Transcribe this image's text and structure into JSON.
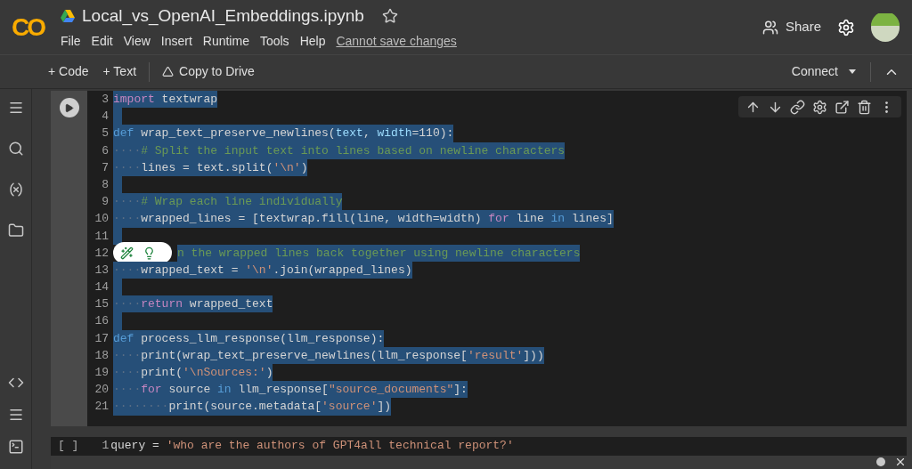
{
  "header": {
    "logo": "CO",
    "title": "Local_vs_OpenAI_Embeddings.ipynb",
    "starred": false,
    "menu": [
      "File",
      "Edit",
      "View",
      "Insert",
      "Runtime",
      "Tools",
      "Help"
    ],
    "save_notice": "Cannot save changes",
    "share": "Share"
  },
  "toolbar": {
    "add_code": "+ Code",
    "add_text": "+ Text",
    "copy": "Copy to Drive",
    "connect": "Connect"
  },
  "cell": {
    "lines": [
      {
        "number": "3",
        "tokens": [
          {
            "kind": "kw",
            "text": "import"
          },
          {
            "kind": "plain",
            "text": " textwrap"
          }
        ]
      },
      {
        "number": "4"
      },
      {
        "number": "5",
        "tokens": [
          {
            "kind": "def",
            "text": "def"
          },
          {
            "kind": "plain",
            "text": " wrap_text_preserve_newlines("
          },
          {
            "kind": "param",
            "text": "text"
          },
          {
            "kind": "plain",
            "text": ", "
          },
          {
            "kind": "param",
            "text": "width"
          },
          {
            "kind": "plain",
            "text": "=110):"
          }
        ]
      },
      {
        "number": "6",
        "indent": "····",
        "tokens": [
          {
            "kind": "comment",
            "text": "# Split the input text into lines based on newline characters"
          }
        ]
      },
      {
        "number": "7",
        "indent": "····",
        "tokens": [
          {
            "kind": "plain",
            "text": "lines = text.split("
          },
          {
            "kind": "str",
            "text": "'\\n'"
          },
          {
            "kind": "plain",
            "text": ")"
          }
        ]
      },
      {
        "number": "8"
      },
      {
        "number": "9",
        "indent": "····",
        "tokens": [
          {
            "kind": "comment",
            "text": "# Wrap each line individually"
          }
        ]
      },
      {
        "number": "10",
        "indent": "····",
        "tokens": [
          {
            "kind": "plain",
            "text": "wrapped_lines = [textwrap.fill(line, width=width) "
          },
          {
            "kind": "kw",
            "text": "for"
          },
          {
            "kind": "plain",
            "text": " line "
          },
          {
            "kind": "def",
            "text": "in"
          },
          {
            "kind": "plain",
            "text": " lines]"
          }
        ]
      },
      {
        "number": "11"
      },
      {
        "number": "12",
        "covered": true,
        "tokens": [
          {
            "kind": "comment",
            "text": "n the wrapped lines back together using newline characters"
          }
        ]
      },
      {
        "number": "13",
        "indent": "····",
        "tokens": [
          {
            "kind": "plain",
            "text": "wrapped_text = "
          },
          {
            "kind": "str",
            "text": "'\\n'"
          },
          {
            "kind": "plain",
            "text": ".join(wrapped_lines)"
          }
        ]
      },
      {
        "number": "14"
      },
      {
        "number": "15",
        "indent": "····",
        "tokens": [
          {
            "kind": "kw",
            "text": "return"
          },
          {
            "kind": "plain",
            "text": " wrapped_text"
          }
        ]
      },
      {
        "number": "16"
      },
      {
        "number": "17",
        "tokens": [
          {
            "kind": "def",
            "text": "def"
          },
          {
            "kind": "plain",
            "text": " process_llm_response(llm_response):"
          }
        ]
      },
      {
        "number": "18",
        "indent": "····",
        "tokens": [
          {
            "kind": "plain",
            "text": "print(wrap_text_preserve_newlines(llm_response["
          },
          {
            "kind": "str",
            "text": "'result'"
          },
          {
            "kind": "plain",
            "text": "]))"
          }
        ]
      },
      {
        "number": "19",
        "indent": "····",
        "tokens": [
          {
            "kind": "plain",
            "text": "print("
          },
          {
            "kind": "str",
            "text": "'\\nSources:'"
          },
          {
            "kind": "plain",
            "text": ")"
          }
        ]
      },
      {
        "number": "20",
        "indent": "····",
        "tokens": [
          {
            "kind": "kw",
            "text": "for"
          },
          {
            "kind": "plain",
            "text": " source "
          },
          {
            "kind": "def",
            "text": "in"
          },
          {
            "kind": "plain",
            "text": " llm_response["
          },
          {
            "kind": "str",
            "text": "\"source_documents\""
          },
          {
            "kind": "plain",
            "text": "]:"
          }
        ]
      },
      {
        "number": "21",
        "indent": "········",
        "tokens": [
          {
            "kind": "plain",
            "text": "print(source.metadata["
          },
          {
            "kind": "str",
            "text": "'source'"
          },
          {
            "kind": "plain",
            "text": "])"
          }
        ]
      }
    ]
  },
  "next_cell": {
    "status": "[ ]",
    "number": "1",
    "tokens": [
      {
        "kind": "plain",
        "text": "query = "
      },
      {
        "kind": "str",
        "text": "'who are the authors of GPT4all technical report?'"
      }
    ]
  }
}
